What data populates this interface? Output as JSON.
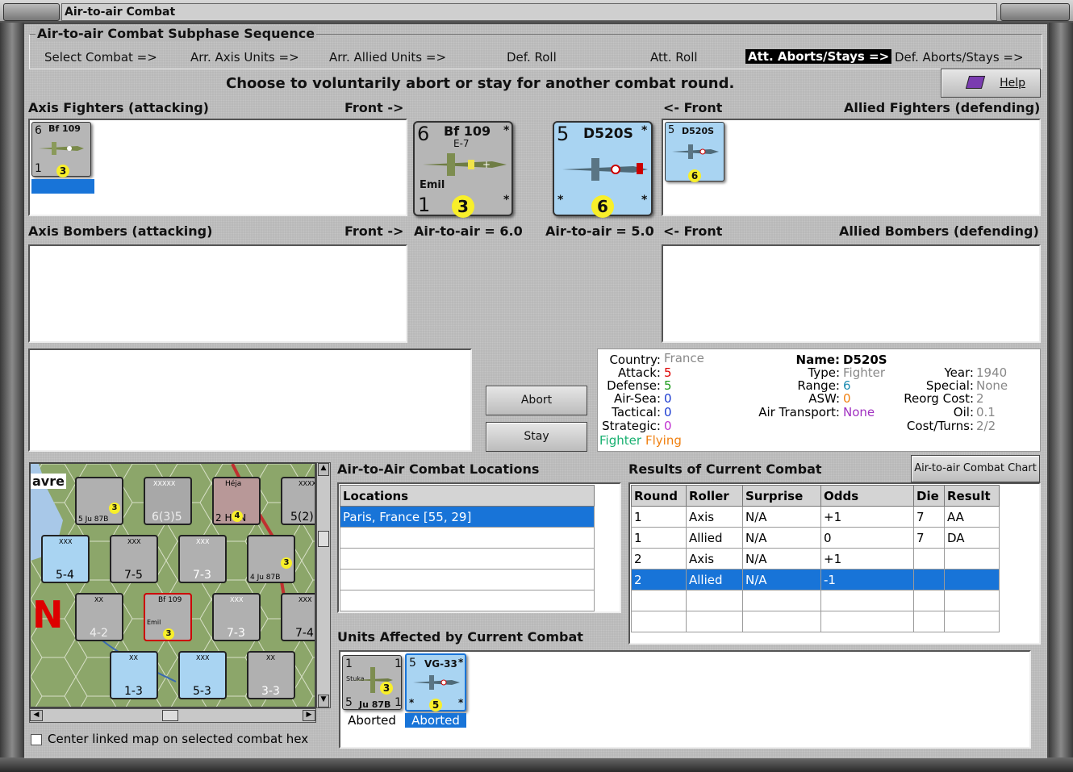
{
  "window": {
    "title": "Air-to-air Combat"
  },
  "sequence": {
    "heading": "Air-to-air Combat Subphase Sequence",
    "steps": [
      "Select Combat =>",
      "Arr. Axis Units =>",
      "Arr. Allied Units =>",
      "Def. Roll",
      "Att. Roll",
      "Att. Aborts/Stays =>",
      "Def. Aborts/Stays =>"
    ],
    "active_step": "Att. Aborts/Stays =>"
  },
  "prompt": "Choose to voluntarily abort or stay for another combat round.",
  "help_label": "Help",
  "labels": {
    "axis_fighters": "Axis Fighters (attacking)",
    "front_right": "Front ->",
    "front_left": "<- Front",
    "allied_fighters": "Allied Fighters (defending)",
    "axis_bombers": "Axis Bombers (attacking)",
    "allied_bombers": "Allied Bombers (defending)",
    "axis_air_to_air": "Air-to-air = 6.0",
    "allied_air_to_air": "Air-to-air = 5.0"
  },
  "axis_counter": {
    "top_left": "6",
    "name": "Bf 109",
    "variant": "E-7",
    "nickname": "Emil",
    "bottom_left": "1",
    "circle": "3",
    "star": "*"
  },
  "allied_counter": {
    "top_left": "5",
    "name": "D520S",
    "bottom_left": "*",
    "circle": "6",
    "star": "*"
  },
  "buttons": {
    "abort": "Abort",
    "stay": "Stay",
    "chart": "Air-to-air Combat Chart"
  },
  "unit_info": {
    "country_label": "Country:",
    "country": "France",
    "attack_label": "Attack:",
    "attack": "5",
    "defense_label": "Defense:",
    "defense": "5",
    "airsea_label": "Air-Sea:",
    "airsea": "0",
    "tactical_label": "Tactical:",
    "tactical": "0",
    "strategic_label": "Strategic:",
    "strategic": "0",
    "kind": "Fighter",
    "mode": "Flying",
    "name_label": "Name:",
    "name": "D520S",
    "type_label": "Type:",
    "type": "Fighter",
    "range_label": "Range:",
    "range": "6",
    "asw_label": "ASW:",
    "asw": "0",
    "transport_label": "Air Transport:",
    "transport": "None",
    "year_label": "Year:",
    "year": "1940",
    "special_label": "Special:",
    "special": "None",
    "reorg_label": "Reorg Cost:",
    "reorg": "2",
    "oil_label": "Oil:",
    "oil": "0.1",
    "cost_label": "Cost/Turns:",
    "cost": "2/2"
  },
  "locations": {
    "heading": "Air-to-Air Combat Locations",
    "column": "Locations",
    "rows": [
      "Paris, France [55, 29]",
      "",
      "",
      "",
      ""
    ]
  },
  "results": {
    "heading": "Results of Current Combat",
    "columns": [
      "Round",
      "Roller",
      "Surprise",
      "Odds",
      "Die",
      "Result"
    ],
    "rows": [
      [
        "1",
        "Axis",
        "N/A",
        "+1",
        "7",
        "AA"
      ],
      [
        "1",
        "Allied",
        "N/A",
        "0",
        "7",
        "DA"
      ],
      [
        "2",
        "Axis",
        "N/A",
        "+1",
        "",
        ""
      ],
      [
        "2",
        "Allied",
        "N/A",
        "-1",
        "",
        ""
      ],
      [
        "",
        "",
        "",
        "",
        "",
        ""
      ],
      [
        "",
        "",
        "",
        "",
        "",
        ""
      ]
    ]
  },
  "affected": {
    "heading": "Units Affected by Current Combat",
    "units": [
      {
        "top": "1",
        "name": "Ju 87B",
        "sub": "Stuka",
        "bl": "5",
        "br": "1",
        "circle": "3",
        "status": "Aborted"
      },
      {
        "top": "5",
        "name": "VG-33",
        "bl": "*",
        "br": "*",
        "circle": "5",
        "status": "Aborted"
      }
    ]
  },
  "center_map_label": "Center linked map on selected combat hex",
  "map": {
    "place_text": "avre",
    "big_text": "N",
    "counters": [
      {
        "t": "Stuka",
        "v": "5 Ju 87B",
        "c": "3"
      },
      {
        "t": "XXXXX",
        "v": "6(3)5"
      },
      {
        "t": "Héja",
        "v": "2 HUN",
        "c": "4"
      },
      {
        "t": "XXXX",
        "v": "5(2)"
      },
      {
        "t": "XXX",
        "v": "5-4"
      },
      {
        "t": "XXX",
        "v": "7-5"
      },
      {
        "t": "XXX",
        "v": "7-3"
      },
      {
        "t": "Stuka",
        "v": "4 Ju 87B",
        "c": "3"
      },
      {
        "t": "XX",
        "v": "4-2"
      },
      {
        "t": "Bf 109",
        "v": "Emil",
        "c": "3"
      },
      {
        "t": "XXX",
        "v": "7-3"
      },
      {
        "t": "XXX",
        "v": "7-4"
      },
      {
        "t": "XX",
        "v": "1-3"
      },
      {
        "t": "XXX",
        "v": "5-3"
      },
      {
        "t": "XX",
        "v": "3-3"
      }
    ]
  }
}
